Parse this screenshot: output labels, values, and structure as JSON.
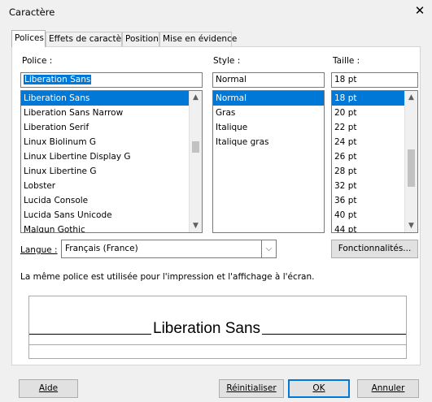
{
  "window": {
    "title": "Caractère",
    "close_glyph": "✕"
  },
  "tabs": [
    "Polices",
    "Effets de caractère",
    "Position",
    "Mise en évidence"
  ],
  "font": {
    "label": "Police :",
    "value": "Liberation Sans",
    "items": [
      "Liberation Sans",
      "Liberation Sans Narrow",
      "Liberation Serif",
      "Linux Biolinum G",
      "Linux Libertine Display G",
      "Linux Libertine G",
      "Lobster",
      "Lucida Console",
      "Lucida Sans Unicode",
      "Malgun Gothic"
    ],
    "selected": "Liberation Sans"
  },
  "style": {
    "label": "Style :",
    "value": "Normal",
    "items": [
      "Normal",
      "Gras",
      "Italique",
      "Italique gras"
    ],
    "selected": "Normal"
  },
  "size": {
    "label": "Taille :",
    "value": "18 pt",
    "items": [
      "18 pt",
      "20 pt",
      "22 pt",
      "24 pt",
      "26 pt",
      "28 pt",
      "32 pt",
      "36 pt",
      "40 pt",
      "44 pt"
    ],
    "selected": "18 pt"
  },
  "language": {
    "label": "Langue :",
    "value": "Français (France)"
  },
  "features_button": "Fonctionnalités...",
  "info_text": "La même police est utilisée pour l'impression et l'affichage à l'écran.",
  "preview": {
    "text": "Liberation Sans"
  },
  "buttons": {
    "help": "Aide",
    "reset": "Réinitialiser",
    "ok": "OK",
    "cancel": "Annuler"
  },
  "icons": {
    "up": "chevron-up-icon",
    "down": "chevron-down-icon",
    "close": "close-icon"
  }
}
